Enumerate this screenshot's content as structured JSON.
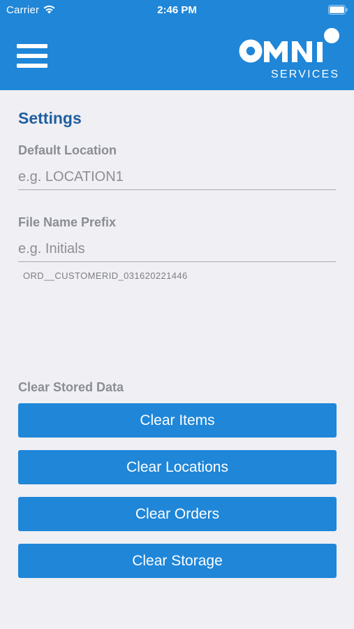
{
  "status_bar": {
    "carrier": "Carrier",
    "time": "2:46 PM"
  },
  "header": {
    "logo_main": "OMNI",
    "logo_sub": "SERVICES",
    "brand_color": "#1f86d8"
  },
  "settings": {
    "title": "Settings",
    "default_location": {
      "label": "Default Location",
      "placeholder": "e.g. LOCATION1",
      "value": ""
    },
    "file_name_prefix": {
      "label": "File Name Prefix",
      "placeholder": "e.g. Initials",
      "value": ""
    },
    "file_name_preview": "ORD__CUSTOMERID_031620221446"
  },
  "clear_stored_data": {
    "label": "Clear Stored Data",
    "buttons": [
      "Clear Items",
      "Clear Locations",
      "Clear Orders",
      "Clear Storage"
    ]
  }
}
